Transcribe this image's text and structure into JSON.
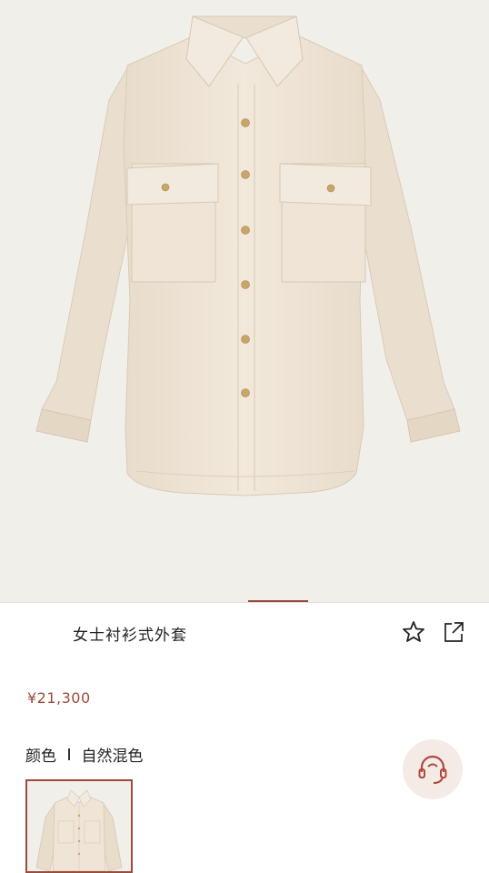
{
  "product": {
    "title": "女士衬衫式外套",
    "price": "¥21,300",
    "color_label": "颜色",
    "color_value": "自然混色"
  },
  "gallery": {
    "active_slide": 2,
    "indicator_color": "#9a4a3a"
  },
  "colors": {
    "accent": "#9b4c3d",
    "garment": "#efe4d5",
    "background": "#f1efea"
  },
  "icons": {
    "favorite": "star-outline-icon",
    "share": "share-arrow-icon",
    "support": "headset-support-icon"
  }
}
